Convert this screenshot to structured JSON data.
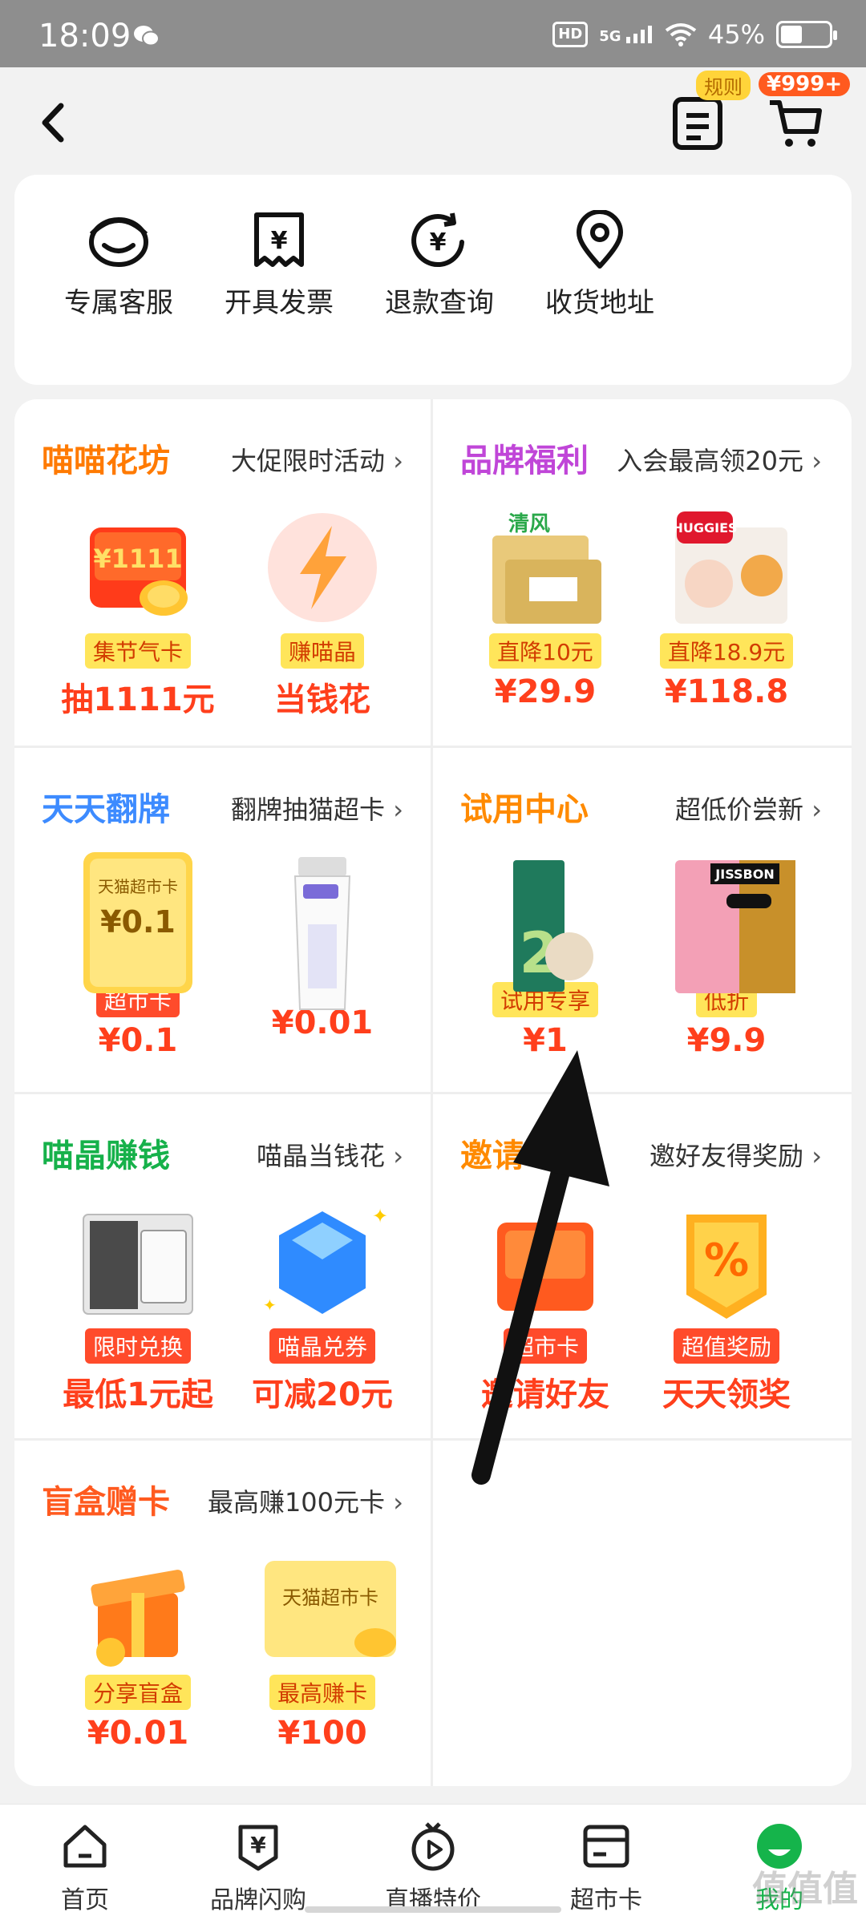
{
  "status_bar": {
    "time": "18:09",
    "hd": "HD",
    "net": "5G",
    "battery": "45%",
    "battery_level": 0.45
  },
  "header": {
    "rules_tag": "规则",
    "cart_tag": "¥999+"
  },
  "services": [
    {
      "label": "专属客服",
      "icon": "customer-service-icon"
    },
    {
      "label": "开具发票",
      "icon": "invoice-icon"
    },
    {
      "label": "退款查询",
      "icon": "refund-icon"
    },
    {
      "label": "收货地址",
      "icon": "location-pin-icon"
    }
  ],
  "sections": [
    {
      "title": "喵喵花坊",
      "title_color": "#ff7a00",
      "subtitle": "大促限时活动",
      "items": [
        {
          "tag": "集节气卡",
          "price": "抽1111元",
          "pic_text": "¥1111"
        },
        {
          "tag": "赚喵晶",
          "price": "当钱花"
        }
      ]
    },
    {
      "title": "品牌福利",
      "title_color": "#c046d8",
      "subtitle": "入会最高领20元",
      "items": [
        {
          "tag": "直降10元",
          "price": "¥29.9",
          "pic_text": "清风"
        },
        {
          "tag": "直降18.9元",
          "price": "¥118.8",
          "pic_text": "HUGGIES"
        }
      ]
    },
    {
      "title": "天天翻牌",
      "title_color": "#3d8bff",
      "subtitle": "翻牌抽猫超卡",
      "items": [
        {
          "tag": "超市卡",
          "price": "¥0.1",
          "pic_text": "天猫超市卡",
          "pic_price": "¥0.1"
        },
        {
          "tag": "",
          "price": "¥0.01"
        }
      ]
    },
    {
      "title": "试用中心",
      "title_color": "#ff8a00",
      "subtitle": "超低价尝新",
      "items": [
        {
          "tag": "试用专享",
          "price": "¥1"
        },
        {
          "tag": "低折",
          "price": "¥9.9",
          "pic_text": "JISSBON"
        }
      ]
    },
    {
      "title": "喵晶赚钱",
      "title_color": "#16b14a",
      "subtitle": "喵晶当钱花",
      "items": [
        {
          "tag": "限时兑换",
          "price": "最低1元起"
        },
        {
          "tag": "喵晶兑券",
          "price": "可减20元"
        }
      ]
    },
    {
      "title": "邀请",
      "title_color": "#ff8a00",
      "subtitle": "邀好友得奖励",
      "items": [
        {
          "tag": "超市卡",
          "price": "邀请好友"
        },
        {
          "tag": "超值奖励",
          "price": "天天领奖"
        }
      ]
    },
    {
      "title": "盲盒赠卡",
      "title_color": "#ff5a1f",
      "subtitle": "最高赚100元卡",
      "items": [
        {
          "tag": "分享盲盒",
          "price": "¥0.01"
        },
        {
          "tag": "最高赚卡",
          "price": "¥100",
          "pic_text": "天猫超市卡"
        }
      ]
    }
  ],
  "tabs": [
    {
      "label": "首页",
      "icon": "home-icon"
    },
    {
      "label": "品牌闪购",
      "icon": "brand-flash-icon"
    },
    {
      "label": "直播特价",
      "icon": "live-icon"
    },
    {
      "label": "超市卡",
      "icon": "card-icon"
    },
    {
      "label": "我的",
      "icon": "mine-icon",
      "active": true
    }
  ],
  "watermark": "值值值"
}
